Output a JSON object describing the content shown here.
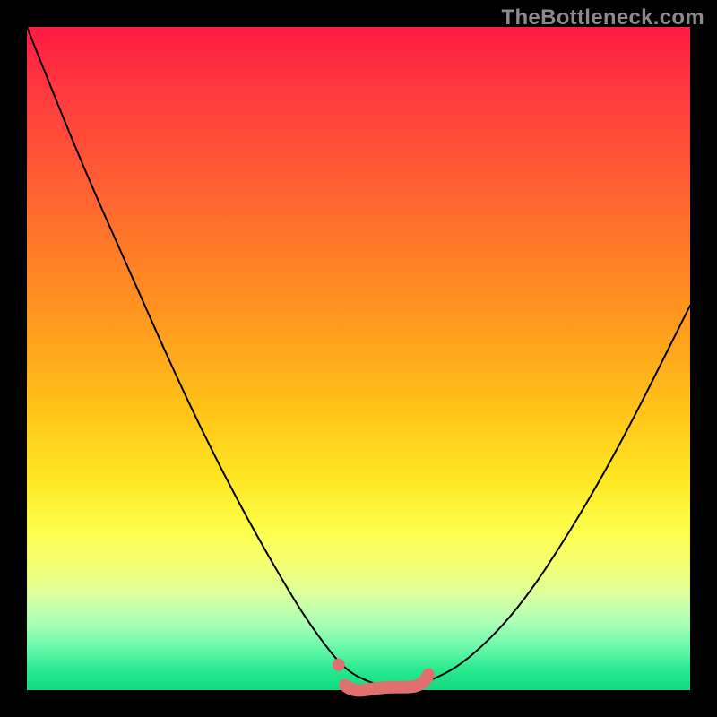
{
  "watermark": "TheBottleneck.com",
  "chart_data": {
    "type": "line",
    "title": "",
    "xlabel": "",
    "ylabel": "",
    "xlim": [
      0,
      100
    ],
    "ylim": [
      0,
      100
    ],
    "x": [
      0,
      8,
      16,
      24,
      32,
      40,
      44,
      48,
      52,
      56,
      60,
      66,
      74,
      82,
      90,
      100
    ],
    "values": [
      100,
      80,
      62,
      44,
      28,
      14,
      8,
      3,
      1,
      0,
      1,
      4,
      12,
      24,
      38,
      58
    ],
    "annotations": [
      {
        "kind": "accent-stroke",
        "x_range": [
          48,
          60
        ],
        "y": 1
      },
      {
        "kind": "accent-dot",
        "x": 47,
        "y": 3
      }
    ],
    "gradient_stops": [
      {
        "pct": 0,
        "color": "#ff1a44"
      },
      {
        "pct": 50,
        "color": "#ffc418"
      },
      {
        "pct": 80,
        "color": "#fdff4c"
      },
      {
        "pct": 100,
        "color": "#12db7e"
      }
    ]
  }
}
